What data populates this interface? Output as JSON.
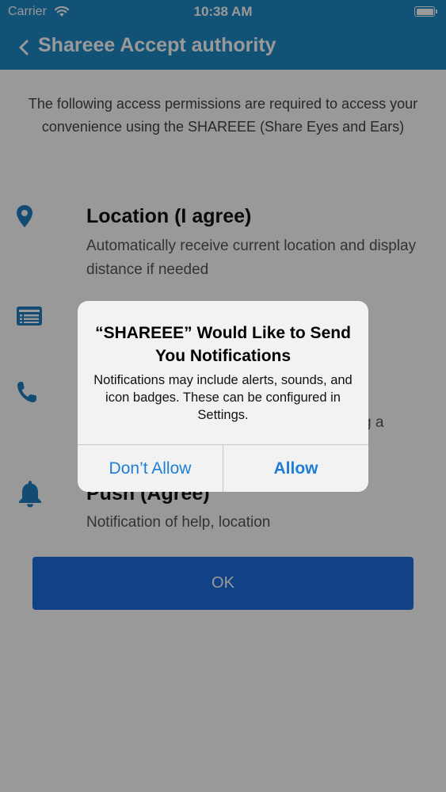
{
  "status_bar": {
    "carrier": "Carrier",
    "time": "10:38 AM"
  },
  "nav": {
    "back_icon": "chevron-left-icon",
    "title": "Shareee Accept authority"
  },
  "intro_text": "The following access permissions are required to access your convenience using the SHAREEE (Share Eyes and Ears)",
  "permissions": [
    {
      "icon": "location-pin-icon",
      "title": "Location (I agree)",
      "description": "Automatically receive current location and display distance if needed"
    },
    {
      "icon": "contacts-card-icon",
      "title": "",
      "description": ""
    },
    {
      "icon": "phone-icon",
      "title": "",
      "description": "g a"
    },
    {
      "icon": "bell-icon",
      "title": "Push (Agree)",
      "description": "Notification of help, location"
    }
  ],
  "ok_button": {
    "label": "OK"
  },
  "alert": {
    "title": "“SHAREEE” Would Like to Send You Notifications",
    "message": "Notifications may include alerts, sounds, and icon badges. These can be configured in Settings.",
    "deny_label": "Don’t Allow",
    "allow_label": "Allow"
  },
  "colors": {
    "nav_bar": "#1f89c7",
    "icon_blue": "#1f7fc4",
    "ok_button": "#1f6fe0",
    "alert_button_text": "#1e7ed6"
  }
}
